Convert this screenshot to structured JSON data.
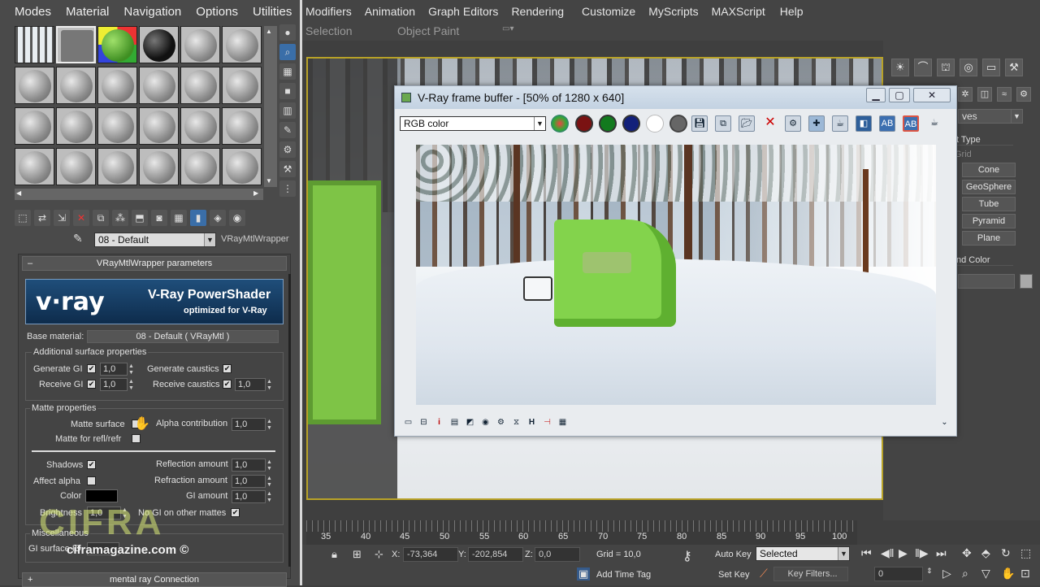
{
  "max": {
    "menu": [
      "Modifiers",
      "Animation",
      "Graph Editors",
      "Rendering",
      "Customize",
      "MyScripts",
      "MAXScript",
      "Help"
    ],
    "ribbon": [
      "Selection",
      "Object Paint"
    ],
    "right_panel": {
      "dropdown": "ves",
      "section": "t Type",
      "grid_label": "Grid",
      "buttons": [
        "Cone",
        "GeoSphere",
        "Tube",
        "Pyramid",
        "Plane"
      ],
      "color_label": "nd Color"
    },
    "timeline_ticks": [
      "35",
      "40",
      "45",
      "50",
      "55",
      "60",
      "65",
      "70",
      "75",
      "80",
      "85",
      "90",
      "95",
      "100"
    ],
    "status": {
      "x_label": "X:",
      "x_value": "-73,364",
      "y_label": "Y:",
      "y_value": "-202,854",
      "z_label": "Z:",
      "z_value": "0,0",
      "grid": "Grid = 10,0",
      "auto_key": "Auto Key",
      "selected": "Selected",
      "set_key": "Set Key",
      "key_filters": "Key Filters...",
      "frame": "0",
      "add_time_tag": "Add Time Tag"
    }
  },
  "mat_editor": {
    "menu": [
      "Modes",
      "Material",
      "Navigation",
      "Options",
      "Utilities"
    ],
    "material_name": "08 - Default",
    "material_type": "VRayMtlWrapper",
    "rollout_title": "VRayMtlWrapper parameters",
    "banner_logo": "v·ray",
    "banner_title": "V-Ray PowerShader",
    "banner_sub": "optimized for V-Ray",
    "base_material_label": "Base material:",
    "base_material_value": "08 - Default  ( VRayMtl )",
    "additional_group": "Additional surface properties",
    "gen_gi": "Generate GI",
    "gen_gi_val": "1,0",
    "gen_caustics": "Generate caustics",
    "recv_gi": "Receive GI",
    "recv_gi_val": "1,0",
    "recv_caustics": "Receive caustics",
    "recv_caustics_val": "1,0",
    "matte_group": "Matte properties",
    "matte_surface": "Matte surface",
    "alpha_contrib": "Alpha contribution",
    "alpha_contrib_val": "1,0",
    "matte_refl": "Matte for refl/refr",
    "shadows": "Shadows",
    "reflection_amount": "Reflection amount",
    "reflection_val": "1,0",
    "affect_alpha": "Affect alpha",
    "refraction_amount": "Refraction amount",
    "refraction_val": "1,0",
    "color": "Color",
    "gi_amount": "GI amount",
    "gi_val": "1,0",
    "brightness": "Brightness",
    "brightness_val": "1,0",
    "no_gi": "No GI on other mattes",
    "misc_group": "Miscellaneous",
    "gi_surface": "GI surface ID",
    "mental_ray": "mental ray Connection",
    "watermark": "CIFRA",
    "watermark_url": "ciframagazine.com ©"
  },
  "vfb": {
    "title": "V-Ray frame buffer - [50% of 1280 x 640]",
    "channel": "RGB color",
    "bottom_h": "H"
  }
}
